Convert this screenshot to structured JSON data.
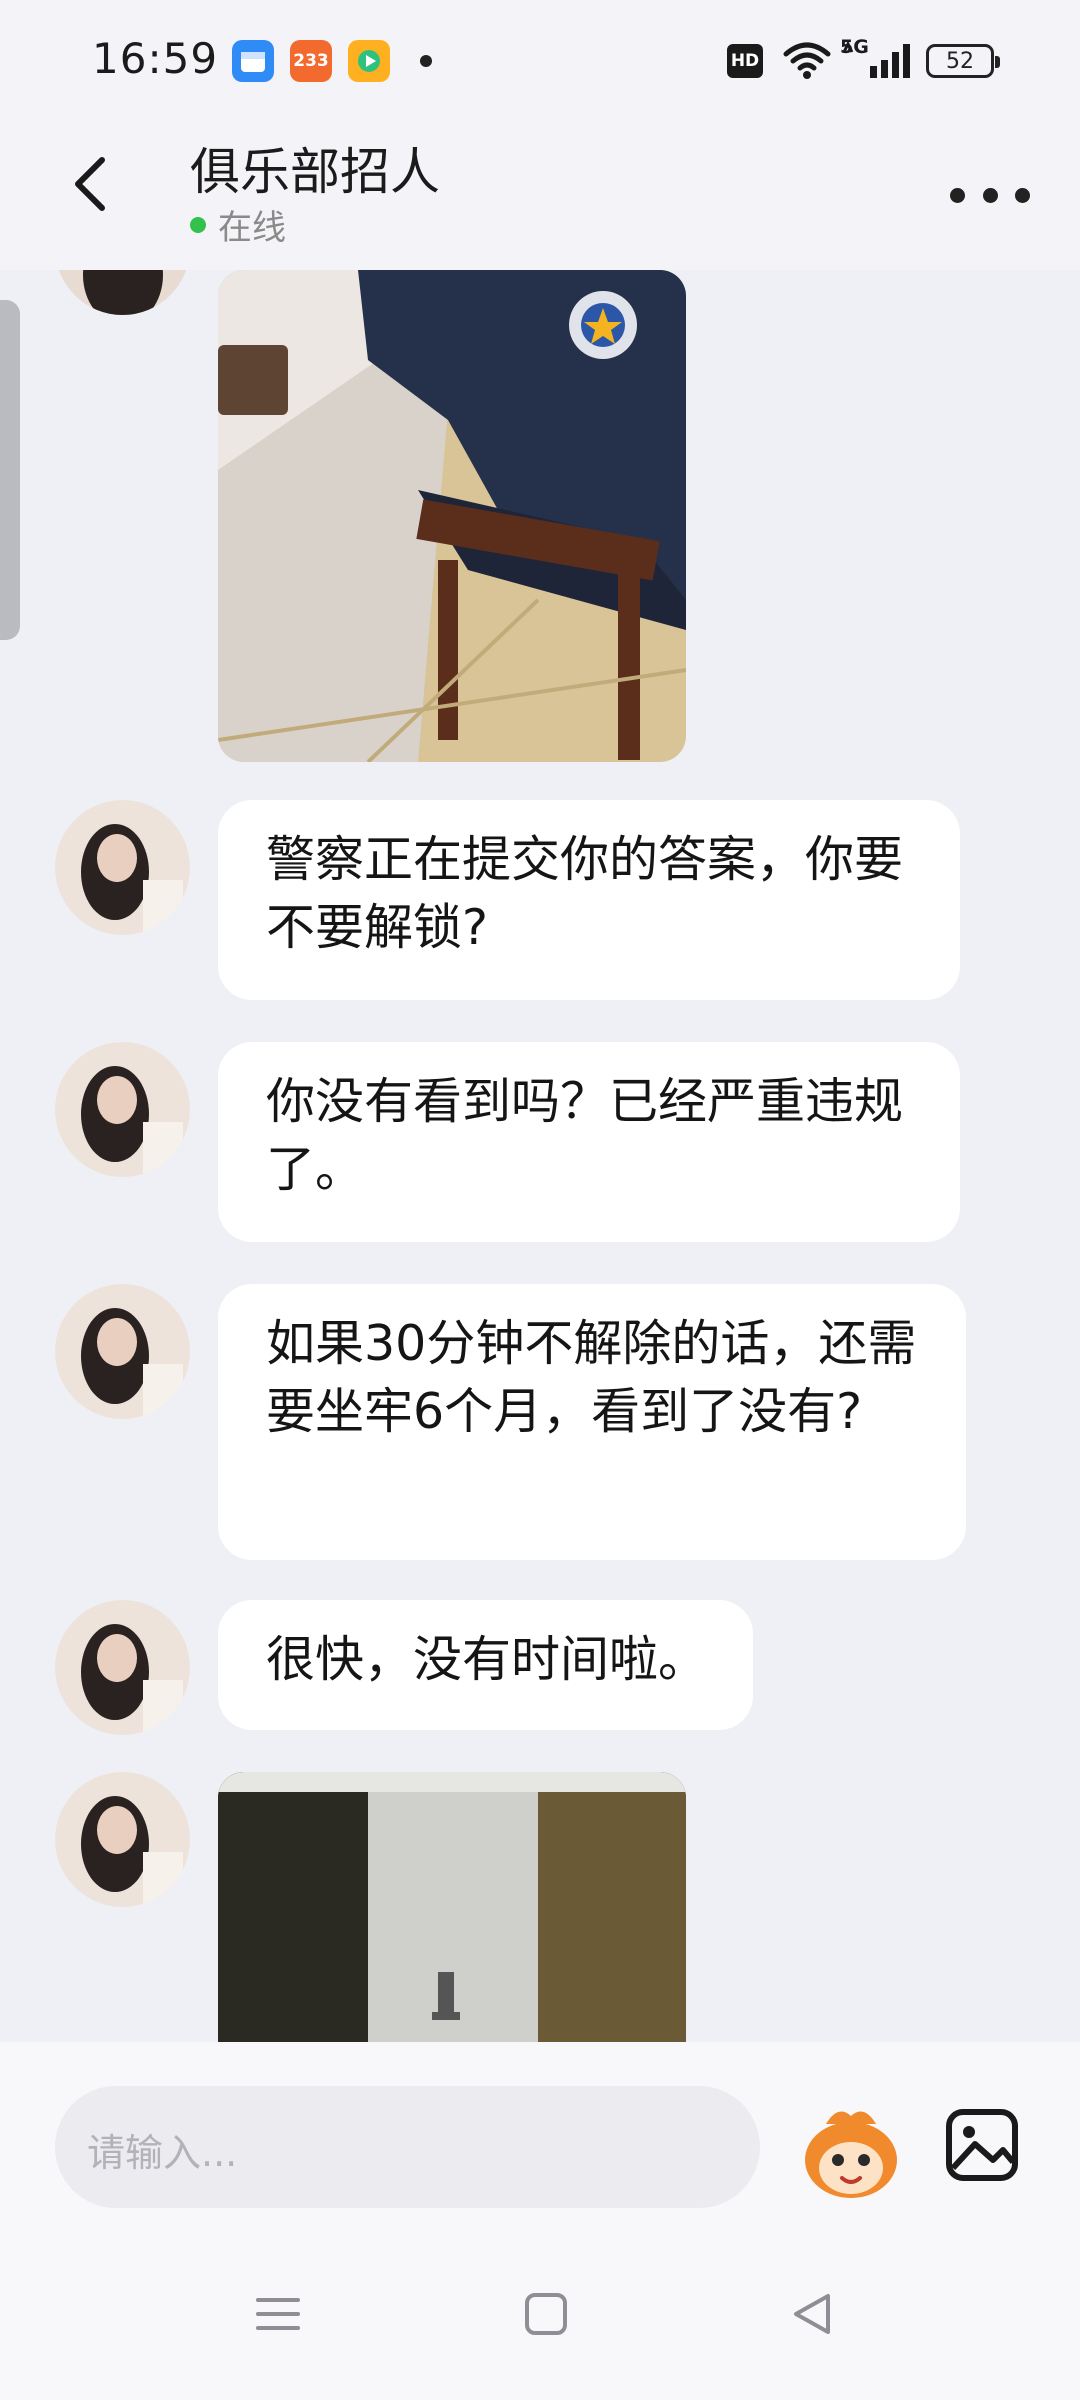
{
  "status_bar": {
    "time": "16:59",
    "app_badge": "233",
    "network": "5G",
    "battery": "52"
  },
  "header": {
    "title": "俱乐部招人",
    "status": "在线"
  },
  "messages": [
    {
      "type": "text",
      "text": "警察正在提交你的答案，你要不要解锁?"
    },
    {
      "type": "text",
      "text": "你没有看到吗？已经严重违规了。"
    },
    {
      "type": "text",
      "text": "如果30分钟不解除的话，还需要坐牢6个月，看到了没有?"
    },
    {
      "type": "text",
      "text": "很快，没有时间啦。"
    }
  ],
  "input": {
    "placeholder": "请输入..."
  },
  "colors": {
    "online": "#33c14c",
    "background": "#eff0f6",
    "bubble": "#ffffff"
  }
}
